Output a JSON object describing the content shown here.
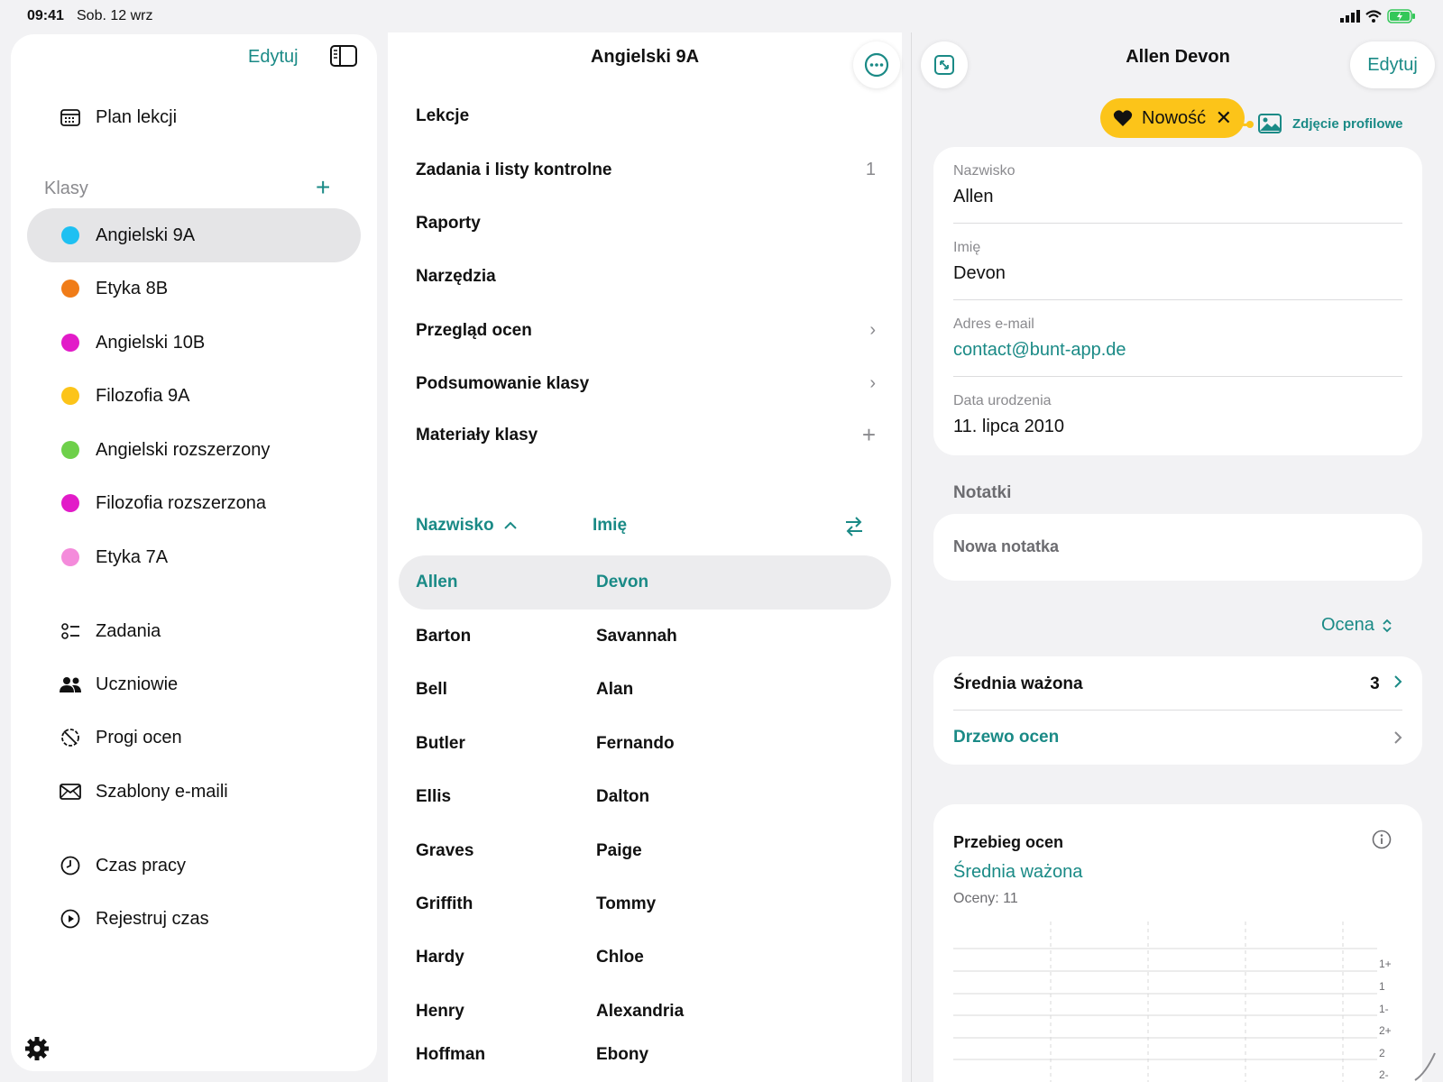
{
  "status": {
    "time": "09:41",
    "date": "Sob. 12 wrz"
  },
  "sidebar": {
    "edit_label": "Edytuj",
    "schedule_label": "Plan lekcji",
    "classes_header": "Klasy",
    "classes": [
      {
        "label": "Angielski 9A",
        "color": "#1ec0f2"
      },
      {
        "label": "Etyka 8B",
        "color": "#f07c18"
      },
      {
        "label": "Angielski 10B",
        "color": "#e21bc8"
      },
      {
        "label": "Filozofia 9A",
        "color": "#fcc419"
      },
      {
        "label": "Angielski rozszerzony",
        "color": "#6ed04a"
      },
      {
        "label": "Filozofia rozszerzona",
        "color": "#e21bc8"
      },
      {
        "label": "Etyka 7A",
        "color": "#f48bdb"
      }
    ],
    "nav": [
      {
        "label": "Zadania",
        "icon": "tasks-icon"
      },
      {
        "label": "Uczniowie",
        "icon": "students-icon"
      },
      {
        "label": "Progi ocen",
        "icon": "grade-thresholds-icon"
      },
      {
        "label": "Szablony e-maili",
        "icon": "envelope-icon"
      }
    ],
    "time": [
      {
        "label": "Czas pracy",
        "icon": "clock-icon"
      },
      {
        "label": "Rejestruj czas",
        "icon": "play-icon"
      }
    ]
  },
  "middle": {
    "title": "Angielski 9A",
    "rows": [
      {
        "label": "Lekcje",
        "accessory": ""
      },
      {
        "label": "Zadania i listy kontrolne",
        "accessory": "1"
      },
      {
        "label": "Raporty",
        "accessory": ""
      },
      {
        "label": "Narzędzia",
        "accessory": ""
      },
      {
        "label": "Przegląd ocen",
        "accessory": "›"
      },
      {
        "label": "Podsumowanie klasy",
        "accessory": "›"
      },
      {
        "label": "Materiały klasy",
        "accessory": "+"
      }
    ],
    "col_lastname": "Nazwisko",
    "col_firstname": "Imię",
    "students": [
      {
        "last": "Allen",
        "first": "Devon"
      },
      {
        "last": "Barton",
        "first": "Savannah"
      },
      {
        "last": "Bell",
        "first": "Alan"
      },
      {
        "last": "Butler",
        "first": "Fernando"
      },
      {
        "last": "Ellis",
        "first": "Dalton"
      },
      {
        "last": "Graves",
        "first": "Paige"
      },
      {
        "last": "Griffith",
        "first": "Tommy"
      },
      {
        "last": "Hardy",
        "first": "Chloe"
      },
      {
        "last": "Henry",
        "first": "Alexandria"
      },
      {
        "last": "Hoffman",
        "first": "Ebony"
      }
    ]
  },
  "detail": {
    "title": "Allen Devon",
    "edit_label": "Edytuj",
    "new_badge": "Nowość",
    "photo_label": "Zdjęcie profilowe",
    "fields": [
      {
        "label": "Nazwisko",
        "value": "Allen"
      },
      {
        "label": "Imię",
        "value": "Devon"
      },
      {
        "label": "Adres e-mail",
        "value": "contact@bunt-app.de"
      },
      {
        "label": "Data urodzenia",
        "value": "11. lipca 2010"
      }
    ],
    "notes_header": "Notatki",
    "new_note": "Nowa notatka",
    "grade_selector": "Ocena",
    "weighted_avg_label": "Średnia ważona",
    "weighted_avg_value": "3",
    "grade_tree_label": "Drzewo ocen",
    "progress_title": "Przebieg ocen",
    "progress_series": "Średnia ważona",
    "progress_count": "Oceny: 11",
    "axis_labels": [
      "1+",
      "1",
      "1-",
      "2+",
      "2",
      "2-"
    ]
  },
  "colors": {
    "accent": "#1a8a86",
    "badge": "#fcc419"
  }
}
